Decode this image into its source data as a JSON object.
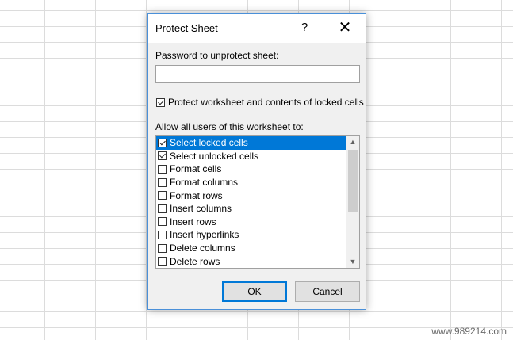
{
  "dialog": {
    "title": "Protect Sheet",
    "help_label": "?",
    "close_label": "✕",
    "password_label": "Password to unprotect sheet:",
    "password_value": "",
    "protect_label": "Protect worksheet and contents of locked cells",
    "protect_checked": true,
    "allow_label": "Allow all users of this worksheet to:",
    "permissions": [
      {
        "label": "Select locked cells",
        "checked": true,
        "selected": true
      },
      {
        "label": "Select unlocked cells",
        "checked": true,
        "selected": false
      },
      {
        "label": "Format cells",
        "checked": false,
        "selected": false
      },
      {
        "label": "Format columns",
        "checked": false,
        "selected": false
      },
      {
        "label": "Format rows",
        "checked": false,
        "selected": false
      },
      {
        "label": "Insert columns",
        "checked": false,
        "selected": false
      },
      {
        "label": "Insert rows",
        "checked": false,
        "selected": false
      },
      {
        "label": "Insert hyperlinks",
        "checked": false,
        "selected": false
      },
      {
        "label": "Delete columns",
        "checked": false,
        "selected": false
      },
      {
        "label": "Delete rows",
        "checked": false,
        "selected": false
      }
    ],
    "ok_label": "OK",
    "cancel_label": "Cancel"
  },
  "watermark": "www.989214.com",
  "colors": {
    "accent": "#0078d7",
    "dialog_border": "#4a90d9",
    "dialog_bg": "#f0f0f0"
  }
}
